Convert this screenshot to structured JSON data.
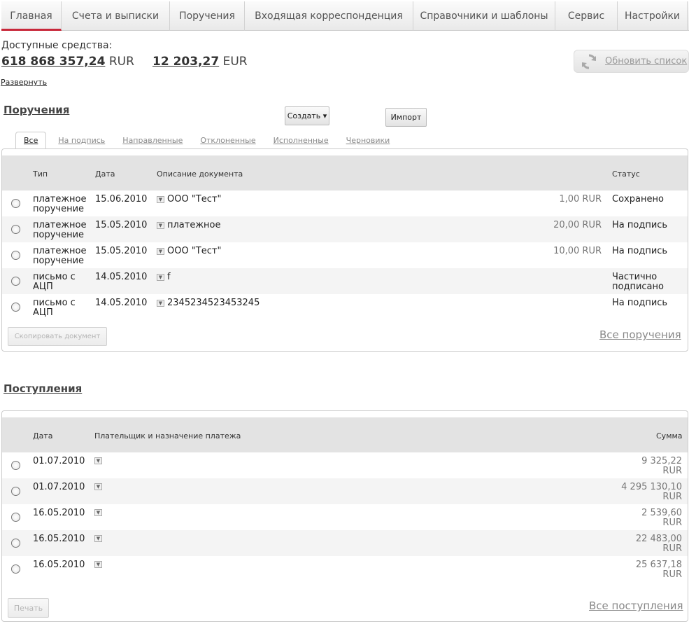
{
  "nav": {
    "items": [
      {
        "label": "Главная",
        "width": 86
      },
      {
        "label": "Счета и выписки",
        "width": 155
      },
      {
        "label": "Поручения",
        "width": 107
      },
      {
        "label": "Входящая корреспонденция",
        "width": 241
      },
      {
        "label": "Справочники и шаблоны",
        "width": 203
      },
      {
        "label": "Сервис",
        "width": 89
      },
      {
        "label": "Настройки",
        "width": 100
      }
    ]
  },
  "funds": {
    "label": "Доступные средства:",
    "rur_amount": "618 868 357,24",
    "rur_currency": "RUR",
    "eur_amount": "12 203,27",
    "eur_currency": "EUR"
  },
  "refresh_label": "Обновить список",
  "expand_label": "Развернуть",
  "orders": {
    "title": "Поручения",
    "create_label": "Создать ▾",
    "import_label": "Импорт",
    "tabs": [
      "Все",
      "На подпись",
      "Направленные",
      "Отклоненные",
      "Исполненные",
      "Черновики"
    ],
    "headers": {
      "type": "Тип",
      "date": "Дата",
      "desc": "Описание документа",
      "status": "Статус"
    },
    "rows": [
      {
        "type": "платежное поручение",
        "date": "15.06.2010",
        "desc": "ООО \"Тест\"",
        "amount": "1,00 RUR",
        "status": "Сохранено"
      },
      {
        "type": "платежное поручение",
        "date": "15.05.2010",
        "desc": "платежное",
        "amount": "20,00 RUR",
        "status": "На подпись"
      },
      {
        "type": "платежное поручение",
        "date": "15.05.2010",
        "desc": "ООО \"Тест\"",
        "amount": "10,00 RUR",
        "status": "На подпись"
      },
      {
        "type": "письмо с АЦП",
        "date": "14.05.2010",
        "desc": "f",
        "amount": "",
        "status": "Частично подписано"
      },
      {
        "type": "письмо с АЦП",
        "date": "14.05.2010",
        "desc": "2345234523453245",
        "amount": "",
        "status": "На подпись"
      }
    ],
    "copy_label": "Скопировать документ",
    "all_link": "Все поручения"
  },
  "income": {
    "title": "Поступления",
    "headers": {
      "date": "Дата",
      "payer": "Плательщик и назначение платежа",
      "sum": "Сумма"
    },
    "rows": [
      {
        "date": "01.07.2010",
        "sum": "9 325,22",
        "cur": "RUR"
      },
      {
        "date": "01.07.2010",
        "sum": "4 295 130,10",
        "cur": "RUR"
      },
      {
        "date": "16.05.2010",
        "sum": "2 539,60",
        "cur": "RUR"
      },
      {
        "date": "16.05.2010",
        "sum": "22 483,00",
        "cur": "RUR"
      },
      {
        "date": "16.05.2010",
        "sum": "25 637,18",
        "cur": "RUR"
      }
    ],
    "print_label": "Печать",
    "all_link": "Все поступления"
  },
  "colors": {
    "accent": "#c8283a",
    "header_bg": "#e3e3e3",
    "row_alt": "#f4f4f4"
  },
  "icons": {
    "refresh": "refresh-icon",
    "expand": "expand-arrow-icon",
    "radio": "radio-button"
  }
}
